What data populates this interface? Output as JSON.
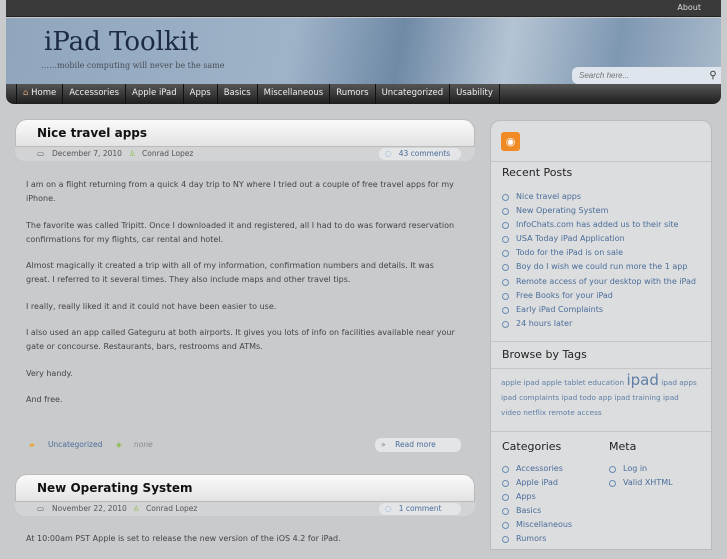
{
  "topbar": {
    "about": "About"
  },
  "header": {
    "title": "iPad Toolkit",
    "tagline": "……mobile computing will never be the same",
    "search_placeholder": "Search here..."
  },
  "nav": [
    "Home",
    "Accessories",
    "Apple iPad",
    "Apps",
    "Basics",
    "Miscellaneous",
    "Rumors",
    "Uncategorized",
    "Usability"
  ],
  "posts": [
    {
      "title": "Nice travel apps",
      "date": "December 7, 2010",
      "author": "Conrad Lopez",
      "comments": "43 comments",
      "paragraphs": [
        "I am on a flight returning from a quick 4 day trip to NY where I tried out a couple of free travel apps for my iPhone.",
        "The favorite was called Tripitt. Once I downloaded it and registered, all I had to do was forward reservation confirmations for my flights, car rental and hotel.",
        "Almost magically it created a trip with all of my information, confirmation numbers and details. It was great. I referred to it several times. They also include maps and other travel tips.",
        "I really, really liked it and it could not have been easier to use.",
        "I also used an app called Gateguru at both airports. It gives you lots of info on facilities available near your gate or concourse. Restaurants, bars, restrooms and ATMs.",
        "Very handy.",
        "And free."
      ],
      "category": "Uncategorized",
      "tags": "none",
      "read_more": "Read more"
    },
    {
      "title": "New Operating System",
      "date": "November 22, 2010",
      "author": "Conrad Lopez",
      "comments": "1 comment",
      "paragraphs": [
        "At 10:00am PST Apple is set to release the new version of the iOS 4.2 for iPad."
      ]
    }
  ],
  "sidebar": {
    "recent_title": "Recent Posts",
    "recent": [
      "Nice travel apps",
      "New Operating System",
      "InfoChats.com has added us to their site",
      "USA Today iPad Application",
      "Todo for the iPad is on sale",
      "Boy do I wish we could run more the 1 app",
      "Remote access of your desktop with the iPad",
      "Free Books for your iPad",
      "Early iPad Complaints",
      "24 hours later"
    ],
    "tags_title": "Browse by Tags",
    "tags": [
      "apple ipad",
      "apple tablet",
      "education",
      "ipad",
      "ipad apps",
      "ipad complaints",
      "ipad todo app",
      "ipad training",
      "ipad video",
      "netflix",
      "remote access"
    ],
    "categories_title": "Categories",
    "categories": [
      "Accessories",
      "Apple iPad",
      "Apps",
      "Basics",
      "Miscellaneous",
      "Rumors"
    ],
    "meta_title": "Meta",
    "meta": [
      "Log in",
      "Valid XHTML"
    ]
  }
}
